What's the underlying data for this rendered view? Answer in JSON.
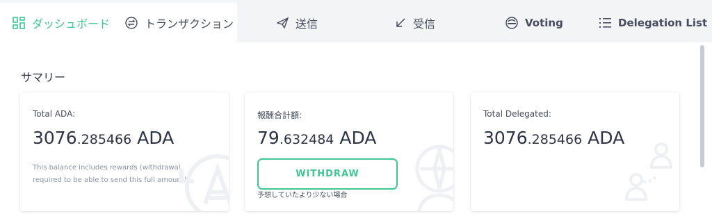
{
  "tabs": [
    {
      "label": "ダッシュボード",
      "icon": "dashboard-icon",
      "active": true
    },
    {
      "label": "トランザクション",
      "icon": "transactions-icon"
    },
    {
      "label": "送信",
      "icon": "send-icon"
    },
    {
      "label": "受信",
      "icon": "receive-icon"
    },
    {
      "label": "Voting",
      "icon": "voting-icon"
    },
    {
      "label": "Delegation List",
      "icon": "list-icon"
    }
  ],
  "summary": {
    "heading": "サマリー",
    "total_ada": {
      "label": "Total ADA:",
      "amount_int": "3076",
      "amount_dec": ".285466",
      "unit": " ADA",
      "note": "This balance includes rewards (withdrawal required to be able to send this full amount)"
    },
    "rewards": {
      "label": "報酬合計額:",
      "amount_int": "79",
      "amount_dec": ".632484",
      "unit": " ADA",
      "withdraw_label": "WITHDRAW",
      "hint": "予想していたより少ない場合"
    },
    "delegated": {
      "label": "Total Delegated:",
      "amount_int": "3076",
      "amount_dec": ".285466",
      "unit": " ADA"
    }
  },
  "colors": {
    "accent": "#3ec792",
    "text": "#2e3447",
    "muted": "#8a92a3",
    "tabbar": "#f2f4f5"
  }
}
